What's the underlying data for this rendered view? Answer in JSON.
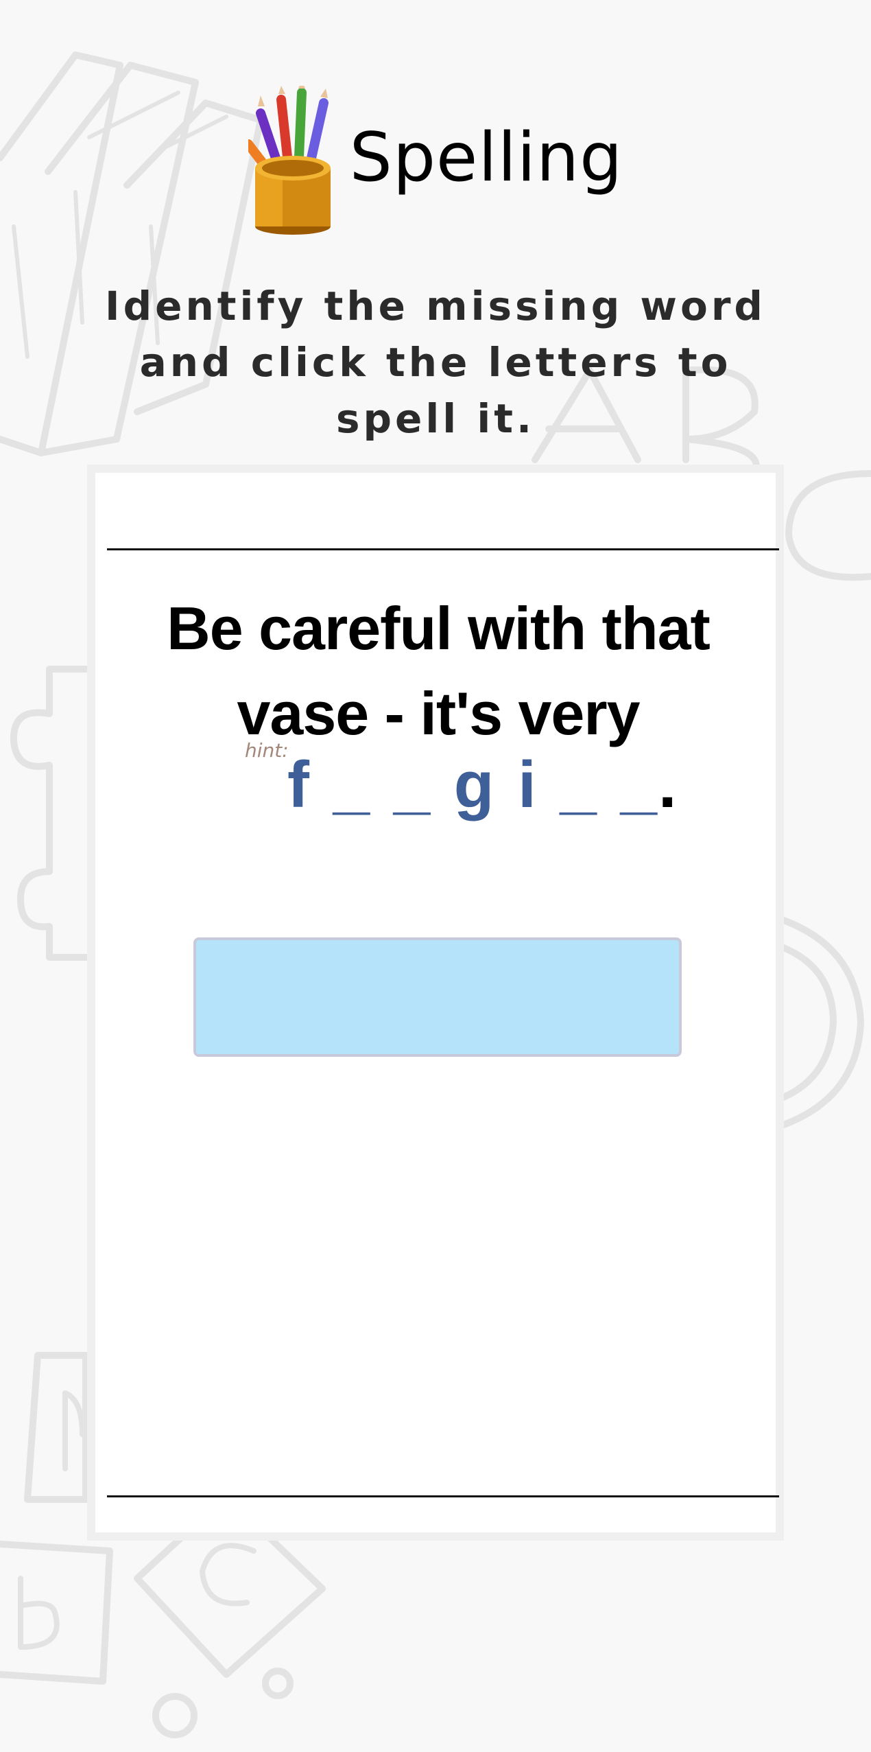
{
  "header": {
    "title": "Spelling",
    "logo_icon": "pencil-cup-icon"
  },
  "instructions": "Identify the missing word and click the letters to spell it.",
  "question": {
    "sentence": "Be careful with that vase - it's very",
    "hint_label": "hint:",
    "hint_pattern": "f _ _ g i _ _",
    "end_punctuation": "."
  },
  "answer": {
    "value": ""
  },
  "colors": {
    "background": "#f8f8f8",
    "card": "#ffffff",
    "hint_text": "#3f5f99",
    "hint_label": "#a3877a",
    "answer_box": "#b5e3fa"
  }
}
